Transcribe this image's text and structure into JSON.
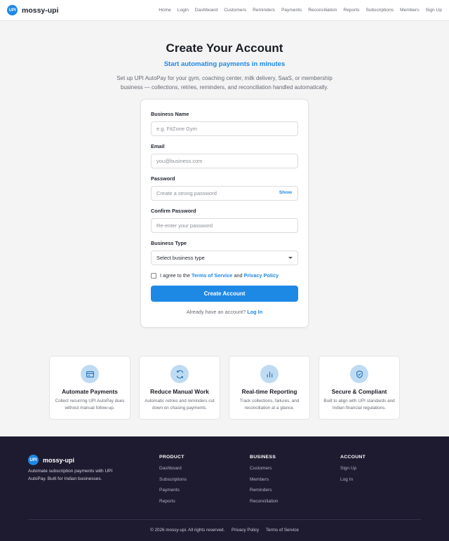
{
  "header": {
    "logo_text": "UPI",
    "brand": "mossy-upi",
    "nav": [
      "Home",
      "Login",
      "Dashboard",
      "Customers",
      "Reminders",
      "Payments",
      "Reconciliation",
      "Reports",
      "Subscriptions",
      "Members",
      "Sign Up"
    ]
  },
  "hero": {
    "title": "Create Your Account",
    "subtitle": "Start automating payments in minutes",
    "description": "Set up UPI AutoPay for your gym, coaching center, milk delivery, SaaS, or membership business — collections, retries, reminders, and reconciliation handled automatically."
  },
  "form": {
    "business_name": {
      "label": "Business Name",
      "placeholder": "e.g. FitZone Gym"
    },
    "email": {
      "label": "Email",
      "placeholder": "you@business.com"
    },
    "password": {
      "label": "Password",
      "placeholder": "Create a strong password",
      "toggle": "Show"
    },
    "confirm_password": {
      "label": "Confirm Password",
      "placeholder": "Re-enter your password"
    },
    "business_type": {
      "label": "Business Type",
      "selected": "Select business type"
    },
    "agree": {
      "prefix": "I agree to the",
      "tos": "Terms of Service",
      "and": "and",
      "privacy": "Privacy Policy"
    },
    "submit": "Create Account",
    "login_prompt": "Already have an account?",
    "login_link": "Log In"
  },
  "features": [
    {
      "icon": "card-icon",
      "title": "Automate Payments",
      "desc": "Collect recurring UPI AutoPay dues without manual follow-up."
    },
    {
      "icon": "refresh-icon",
      "title": "Reduce Manual Work",
      "desc": "Automatic retries and reminders cut down on chasing payments."
    },
    {
      "icon": "bar-chart-icon",
      "title": "Real-time Reporting",
      "desc": "Track collections, failures, and reconciliation at a glance."
    },
    {
      "icon": "shield-check-icon",
      "title": "Secure & Compliant",
      "desc": "Built to align with UPI standards and Indian financial regulations."
    }
  ],
  "footer": {
    "logo_text": "UPI",
    "brand": "mossy-upi",
    "tagline": "Automate subscription payments with UPI AutoPay. Built for Indian businesses.",
    "columns": [
      {
        "title": "PRODUCT",
        "links": [
          "Dashboard",
          "Subscriptions",
          "Payments",
          "Reports"
        ]
      },
      {
        "title": "BUSINESS",
        "links": [
          "Customers",
          "Members",
          "Reminders",
          "Reconciliation"
        ]
      },
      {
        "title": "ACCOUNT",
        "links": [
          "Sign Up",
          "Log In"
        ]
      }
    ],
    "copyright": "© 2026 mossy-upi. All rights reserved.",
    "bottom_links": [
      "Privacy Policy",
      "Terms of Service"
    ]
  },
  "colors": {
    "accent": "#1e88e5",
    "footer_bg": "#1e1b30",
    "icon_bg": "#bfdbf3"
  }
}
